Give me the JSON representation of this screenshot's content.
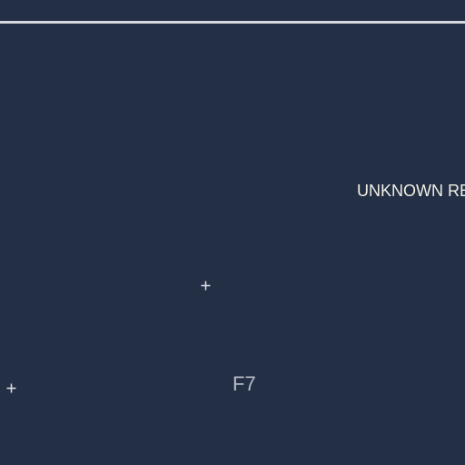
{
  "map": {
    "background_color": "#232f45",
    "border_color": "#d4d7dc",
    "region_label": "UNKNOWN REGION",
    "region_label_color": "#f2f0e6",
    "grid_label": "F7",
    "grid_label_color": "#b7bcc6",
    "marker_color": "#d9dce2",
    "markers": [
      {
        "icon": "crosshair-icon"
      },
      {
        "icon": "crosshair-icon"
      }
    ]
  }
}
